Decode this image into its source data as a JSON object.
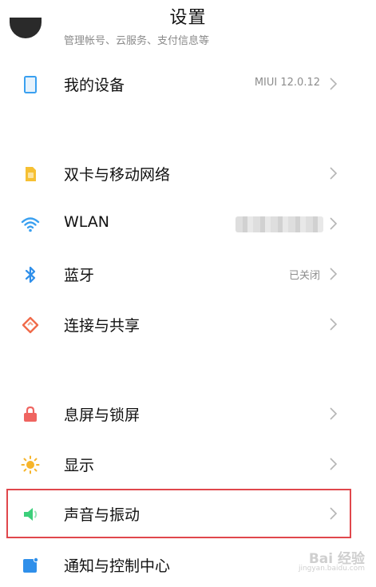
{
  "header": {
    "title": "设置"
  },
  "account": {
    "subtitle": "管理帐号、云服务、支付信息等"
  },
  "rows": [
    {
      "label": "我的设备",
      "value": "MIUI 12.0.12",
      "icon": "device-icon",
      "color": "#3aa0f0"
    },
    {
      "label": "双卡与移动网络",
      "value": "",
      "icon": "sim-card-icon",
      "color": "#f6c033"
    },
    {
      "label": "WLAN",
      "value": "",
      "icon": "wifi-icon",
      "color": "#3aa0f0"
    },
    {
      "label": "蓝牙",
      "value": "已关闭",
      "icon": "bluetooth-icon",
      "color": "#2f8fea"
    },
    {
      "label": "连接与共享",
      "value": "",
      "icon": "share-icon",
      "color": "#f06b4a"
    },
    {
      "label": "息屏与锁屏",
      "value": "",
      "icon": "lock-icon",
      "color": "#ef6460"
    },
    {
      "label": "显示",
      "value": "",
      "icon": "sun-icon",
      "color": "#f6b52c"
    },
    {
      "label": "声音与振动",
      "value": "",
      "icon": "speaker-icon",
      "color": "#3ccf7a"
    },
    {
      "label": "通知与控制中心",
      "value": "",
      "icon": "notification-icon",
      "color": "#2f8fea"
    }
  ],
  "highlight_color": "#e0474c",
  "watermark": {
    "main": "Bai 经验",
    "sub": "jingyan.baidu.com"
  }
}
